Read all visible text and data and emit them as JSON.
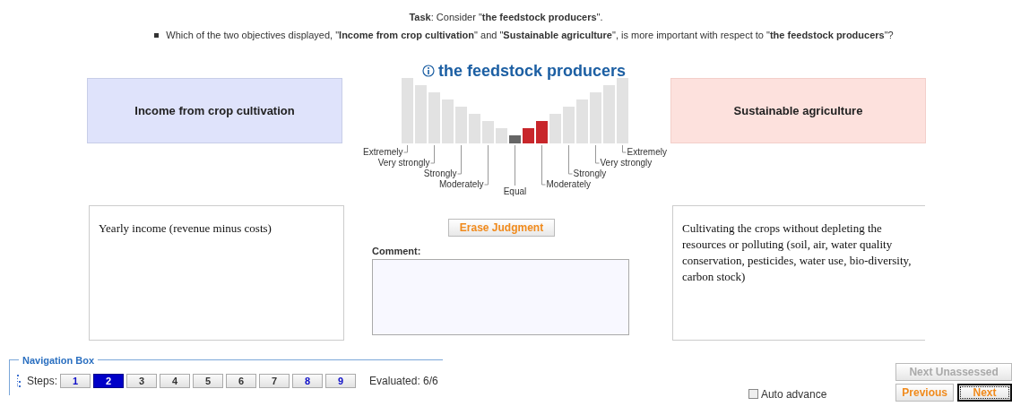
{
  "task": "**Task**: Consider \"**the feedstock producers**\".",
  "question": "Which of the two objectives displayed, \"**Income from crop cultivation**\" and \"**Sustainable agriculture**\", is more important with respect to \"**the feedstock producers**\"?",
  "criterion": "the feedstock producers",
  "objectives": [
    {
      "name": "Income from crop cultivation",
      "color": "#dfe3fb",
      "description": "Yearly income (revenue minus costs)"
    },
    {
      "name": "Sustainable agriculture",
      "color": "#fde1dd",
      "description": "Cultivating the crops without depleting the resources or polluting (soil, air, water quality conservation, pesticides, water use, bio-diversity, carbon stock)"
    }
  ],
  "scale": {
    "bars": [
      {
        "kind": "empty"
      },
      {
        "kind": "empty"
      },
      {
        "kind": "empty"
      },
      {
        "kind": "empty"
      },
      {
        "kind": "empty"
      },
      {
        "kind": "empty"
      },
      {
        "kind": "empty"
      },
      {
        "kind": "empty"
      },
      {
        "kind": "equal"
      },
      {
        "kind": "chosen"
      },
      {
        "kind": "chosen"
      },
      {
        "kind": "empty"
      },
      {
        "kind": "empty"
      },
      {
        "kind": "empty"
      },
      {
        "kind": "empty"
      },
      {
        "kind": "empty"
      },
      {
        "kind": "empty"
      }
    ],
    "left_labels": [
      "Extremely",
      "Very strongly",
      "Strongly",
      "Moderately"
    ],
    "center_label": "Equal",
    "right_labels": [
      "Moderately",
      "Strongly",
      "Very strongly",
      "Extremely"
    ]
  },
  "erase_button": "Erase Judgment",
  "comment_label": "Comment:",
  "navigation": {
    "title": "Navigation Box",
    "steps_label": "Steps:",
    "steps": [
      {
        "label": "1",
        "selected": false,
        "highlighted": true
      },
      {
        "label": "2",
        "selected": true,
        "highlighted": true
      },
      {
        "label": "3",
        "selected": false,
        "highlighted": false
      },
      {
        "label": "4",
        "selected": false,
        "highlighted": false
      },
      {
        "label": "5",
        "selected": false,
        "highlighted": false
      },
      {
        "label": "6",
        "selected": false,
        "highlighted": false
      },
      {
        "label": "7",
        "selected": false,
        "highlighted": false
      },
      {
        "label": "8",
        "selected": false,
        "highlighted": true
      },
      {
        "label": "9",
        "selected": false,
        "highlighted": true
      }
    ],
    "evaluated": "Evaluated: 6/6"
  },
  "auto_advance": {
    "label": "Auto advance",
    "checked": false
  },
  "next_unassessed": {
    "label": "Next Unassessed",
    "disabled": true
  },
  "previous": {
    "label": "Previous",
    "disabled": false
  },
  "next": {
    "label": "Next",
    "disabled": false
  }
}
